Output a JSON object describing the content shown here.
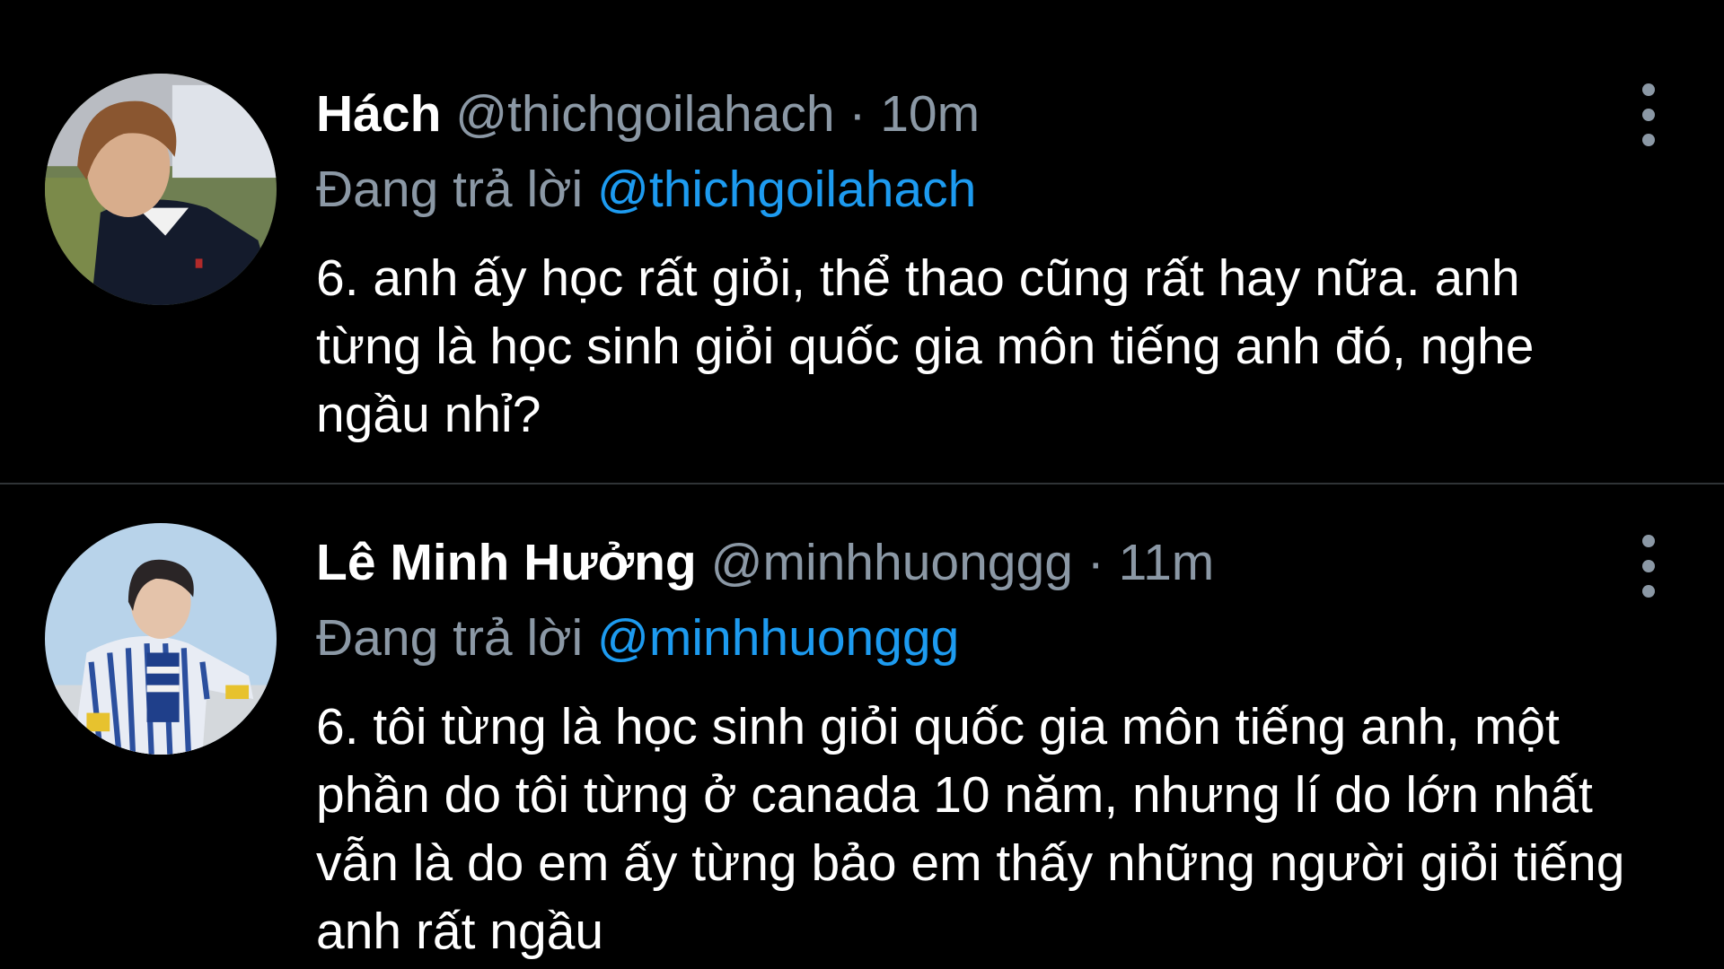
{
  "tweets": [
    {
      "display_name": "Hách",
      "handle": "@thichgoilahach",
      "separator": "·",
      "time": "10m",
      "reply_prefix": "Đang trả lời",
      "reply_to": "@thichgoilahach",
      "text": "6. anh ấy học rất giỏi, thể thao cũng rất hay nữa. anh từng là học sinh giỏi quốc gia môn tiếng anh đó, nghe ngầu nhỉ?",
      "avatar_icon": "profile-photo"
    },
    {
      "display_name": "Lê Minh Hưởng",
      "handle": "@minhhuonggg",
      "separator": "·",
      "time": "11m",
      "reply_prefix": "Đang trả lời",
      "reply_to": "@minhhuonggg",
      "text": "6. tôi từng là học sinh giỏi quốc gia môn tiếng anh, một phần do tôi từng ở canada 10 năm, nhưng lí do lớn nhất vẫn là do em ấy từng bảo em thấy những người giỏi tiếng anh rất ngầu",
      "avatar_icon": "profile-photo"
    }
  ],
  "colors": {
    "background": "#000000",
    "text_primary": "#ffffff",
    "text_secondary": "#8b98a5",
    "link": "#1d9bf0",
    "divider": "#2f3336"
  },
  "icons": {
    "more": "more-vertical-icon"
  }
}
